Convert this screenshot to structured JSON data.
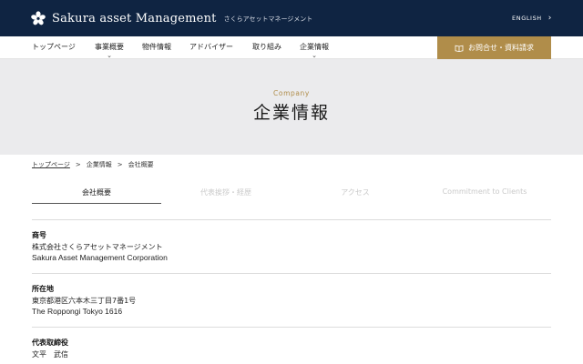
{
  "header": {
    "logo_text": "Sakura asset Management",
    "logo_sub": "さくらアセットマネージメント",
    "lang_label": "ENGLISH",
    "brand_color": "#0f2442",
    "accent_color": "#b08d4a"
  },
  "nav": {
    "items": [
      {
        "label": "トップページ"
      },
      {
        "label": "事業概要"
      },
      {
        "label": "物件情報"
      },
      {
        "label": "アドバイザー"
      },
      {
        "label": "取り組み"
      },
      {
        "label": "企業情報"
      }
    ],
    "cta_label": "お問合せ・資料請求"
  },
  "hero": {
    "title_en": "Company",
    "title_ja": "企業情報"
  },
  "breadcrumb": {
    "items": [
      "トップページ",
      "企業情報",
      "会社概要"
    ],
    "separator": ">"
  },
  "tabs": [
    {
      "label": "会社概要"
    },
    {
      "label": "代表挨拶・経歴"
    },
    {
      "label": "アクセス"
    },
    {
      "label": "Commitment to Clients"
    }
  ],
  "company_info": [
    {
      "label": "商号",
      "lines": [
        "株式会社さくらアセットマネージメント",
        "Sakura Asset Management Corporation"
      ]
    },
    {
      "label": "所在地",
      "lines": [
        "東京都港区六本木三丁目7番1号",
        "The Roppongi Tokyo 1616"
      ]
    },
    {
      "label": "代表取締役",
      "lines": [
        "文平　武信"
      ]
    }
  ]
}
